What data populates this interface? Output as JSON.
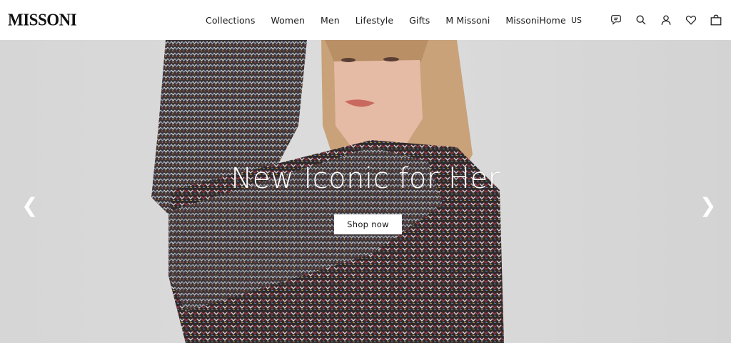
{
  "brand": {
    "logo": "MISSONI"
  },
  "nav": {
    "items": [
      "Collections",
      "Women",
      "Men",
      "Lifestyle",
      "Gifts",
      "M Missoni",
      "MissoniHome"
    ]
  },
  "utilities": {
    "region": "US",
    "icons": [
      "chat-icon",
      "search-icon",
      "account-icon",
      "wishlist-heart-icon",
      "shopping-bag-icon"
    ]
  },
  "hero": {
    "title": "New Iconic for Her",
    "cta_label": "Shop now",
    "prev_arrow": "❮",
    "next_arrow": "❯",
    "colors": {
      "background": "#d8d8d8",
      "sweater_dark": "#3a3436",
      "hair": "#c9a27a",
      "skin": "#e6bba5"
    }
  }
}
